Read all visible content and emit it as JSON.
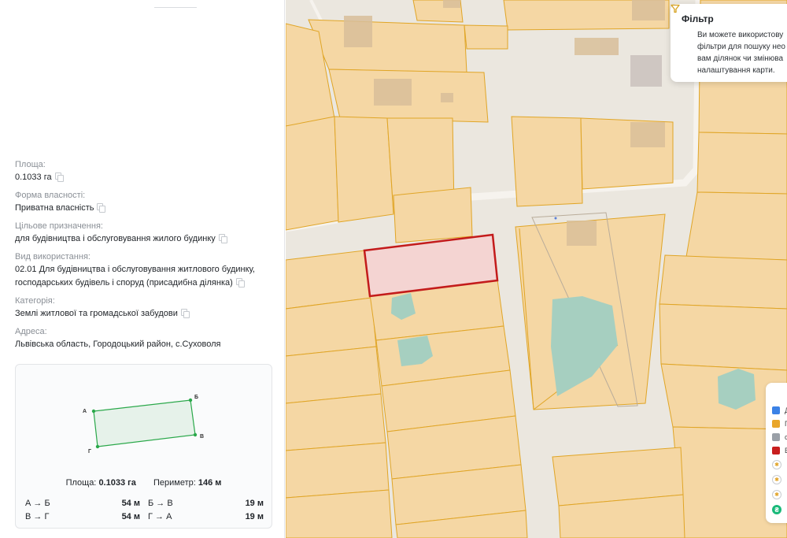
{
  "properties": [
    {
      "label": "Площа:",
      "value": "0.1033 га",
      "copyable": true
    },
    {
      "label": "Форма власності:",
      "value": "Приватна власність",
      "copyable": true
    },
    {
      "label": "Цільове призначення:",
      "value": "для будівництва і обслуговування жилого будинку",
      "copyable": true
    },
    {
      "label": "Вид використання:",
      "value_lines": [
        "02.01 Для будівництва і обслуговування житлового будинку,",
        "господарських будівель і споруд (присадибна ділянка)"
      ],
      "copyable": true
    },
    {
      "label": "Категорія:",
      "value": "Землі житлової та громадської забудови",
      "copyable": true
    },
    {
      "label": "Адреса:",
      "value": "Львівська область, Городоцький район, с.Суховоля",
      "copyable": false
    }
  ],
  "shape": {
    "vertex_labels": [
      "А",
      "Б",
      "В",
      "Г"
    ],
    "area_label": "Площа:",
    "area_value": "0.1033 га",
    "perimeter_label": "Периметр:",
    "perimeter_value": "146 м",
    "sides_left": [
      {
        "name": "А → Б",
        "value": "54 м"
      },
      {
        "name": "В → Г",
        "value": "54 м"
      }
    ],
    "sides_right": [
      {
        "name": "Б → В",
        "value": "19 м"
      },
      {
        "name": "Г → А",
        "value": "19 м"
      }
    ],
    "outline_color": "#2aa84a"
  },
  "filter": {
    "title": "Фільтр",
    "icon": "filter-funnel-icon",
    "text_lines": [
      "Ви можете використову",
      "фільтри для пошуку нео",
      "вам ділянок чи змінюва",
      "налаштування карти."
    ]
  },
  "legend": {
    "items": [
      {
        "color": "#3b82e6",
        "label": "Д"
      },
      {
        "color": "#e9a62a",
        "label": "Г"
      },
      {
        "color": "#9aa0a8",
        "label": "с"
      },
      {
        "color": "#c81e1e",
        "label": "В"
      }
    ],
    "icons": [
      "layer-icon",
      "layer-icon",
      "layer-icon",
      "hryvnia-icon"
    ],
    "hryvnia_glyph": "₴"
  },
  "colors": {
    "parcel_fill": "#f5d7a4",
    "parcel_stroke": "#e0a526",
    "selected_fill": "#f4d4d2",
    "selected_stroke": "#c31b1b",
    "building": "#d9bf9a",
    "vegetation": "#a6cfc0",
    "road": "#ebe7df"
  }
}
